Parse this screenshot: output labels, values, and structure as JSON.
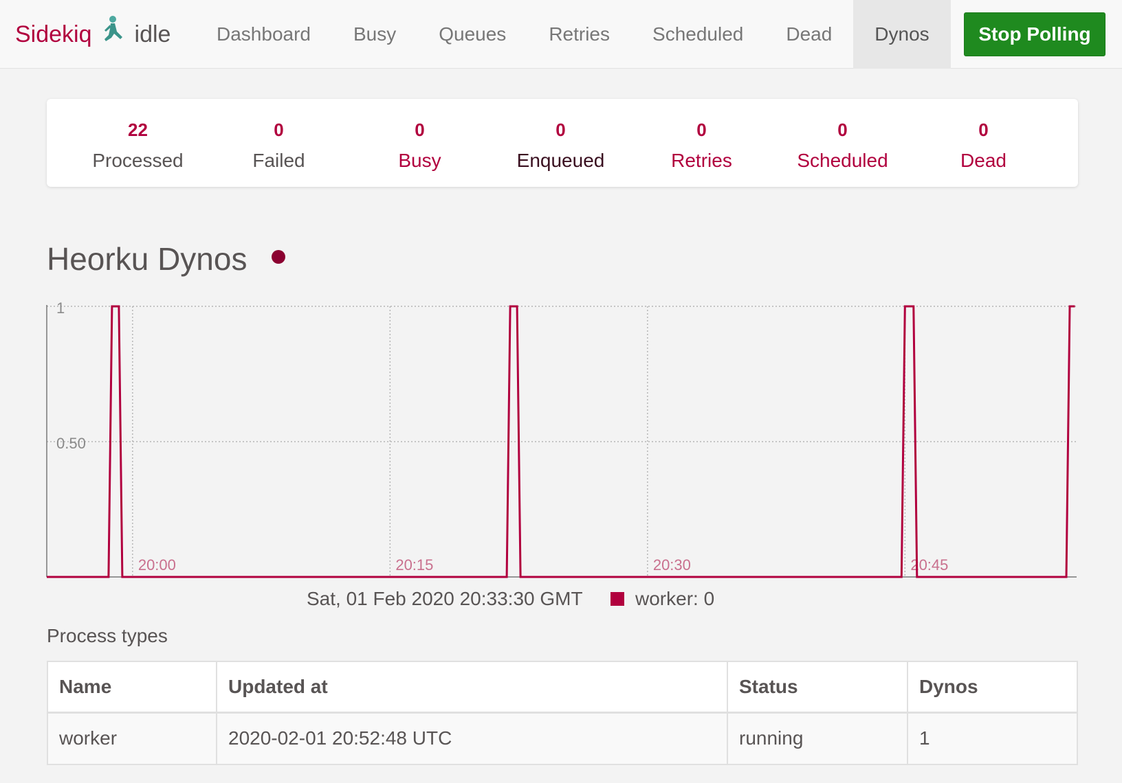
{
  "navbar": {
    "brand": "Sidekiq",
    "status": "idle",
    "items": [
      {
        "label": "Dashboard",
        "active": false
      },
      {
        "label": "Busy",
        "active": false
      },
      {
        "label": "Queues",
        "active": false
      },
      {
        "label": "Retries",
        "active": false
      },
      {
        "label": "Scheduled",
        "active": false
      },
      {
        "label": "Dead",
        "active": false
      },
      {
        "label": "Dynos",
        "active": true
      }
    ],
    "stop_polling_label": "Stop Polling"
  },
  "summary": {
    "processed": {
      "count": "22",
      "label": "Processed"
    },
    "failed": {
      "count": "0",
      "label": "Failed"
    },
    "busy": {
      "count": "0",
      "label": "Busy"
    },
    "enqueued": {
      "count": "0",
      "label": "Enqueued"
    },
    "retries": {
      "count": "0",
      "label": "Retries"
    },
    "scheduled": {
      "count": "0",
      "label": "Scheduled"
    },
    "dead": {
      "count": "0",
      "label": "Dead"
    }
  },
  "page": {
    "title": "Heorku Dynos"
  },
  "colors": {
    "brand": "#b1003e",
    "stop_button": "#1f8a1f",
    "series": "#b1003e",
    "beacon": "#8b0030"
  },
  "chart_data": {
    "type": "line",
    "x_unit": "minutes since 19:55",
    "x_ticks": [
      {
        "x": 5,
        "label": "20:00"
      },
      {
        "x": 20,
        "label": "20:15"
      },
      {
        "x": 35,
        "label": "20:30"
      },
      {
        "x": 50,
        "label": "20:45"
      }
    ],
    "y_ticks": [
      {
        "y": 0.5,
        "label": "0.50"
      },
      {
        "y": 1,
        "label": "1"
      }
    ],
    "xlim": [
      0,
      60
    ],
    "ylim": [
      0,
      1
    ],
    "grid": true,
    "series": [
      {
        "name": "worker",
        "points": [
          [
            0,
            0
          ],
          [
            3.6,
            0
          ],
          [
            3.8,
            1
          ],
          [
            4.2,
            1
          ],
          [
            4.4,
            0
          ],
          [
            26.8,
            0
          ],
          [
            27.0,
            1
          ],
          [
            27.4,
            1
          ],
          [
            27.6,
            0
          ],
          [
            49.8,
            0
          ],
          [
            50.0,
            1
          ],
          [
            50.5,
            1
          ],
          [
            50.7,
            0
          ],
          [
            59.4,
            0
          ],
          [
            59.6,
            1
          ],
          [
            59.9,
            1
          ]
        ]
      }
    ],
    "hover_time": "Sat, 01 Feb 2020 20:33:30 GMT",
    "legend_text": "worker: 0"
  },
  "process_types": {
    "title": "Process types",
    "columns": [
      "Name",
      "Updated at",
      "Status",
      "Dynos"
    ],
    "rows": [
      [
        "worker",
        "2020-02-01 20:52:48 UTC",
        "running",
        "1"
      ]
    ]
  }
}
